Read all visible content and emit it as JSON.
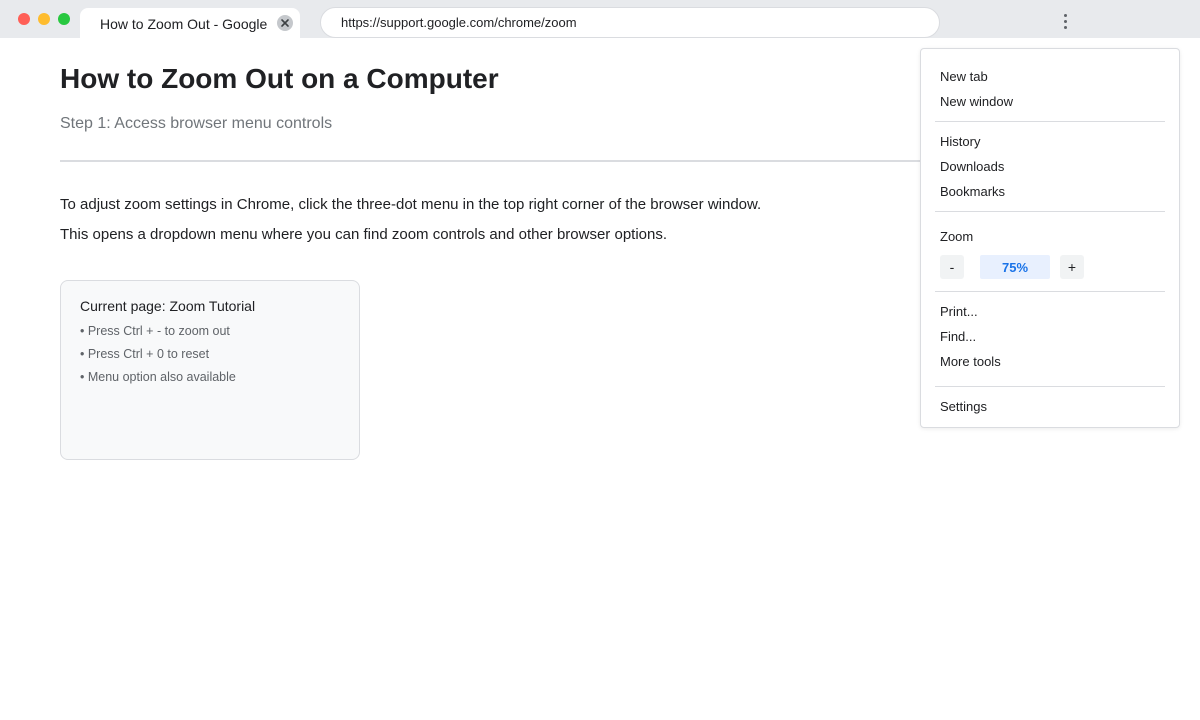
{
  "browser": {
    "tab": {
      "title": "How to Zoom Out - Google"
    },
    "address_bar": {
      "url": "https://support.google.com/chrome/zoom"
    },
    "colors": {
      "accent": "#1a73e8",
      "zoom_highlight": "#e8f0fe"
    },
    "icons": {
      "close_tab": "close-icon",
      "menu": "three-dot-menu-icon"
    }
  },
  "page": {
    "title": "How to Zoom Out on a Computer",
    "subtitle": "Step 1: Access browser menu controls",
    "paragraphs": [
      "To adjust zoom settings in Chrome, click the three-dot menu in the top right corner of the browser window.",
      "This opens a dropdown menu where you can find zoom controls and other browser options."
    ],
    "info_card": {
      "title": "Current page: Zoom Tutorial",
      "items": [
        "• Press Ctrl + - to zoom out",
        "• Press Ctrl + 0 to reset",
        "• Menu option also available"
      ]
    }
  },
  "menu": {
    "new_tab": "New tab",
    "new_window": "New window",
    "history": "History",
    "downloads": "Downloads",
    "bookmarks": "Bookmarks",
    "zoom": {
      "label": "Zoom",
      "decrease": "-",
      "value": "75%",
      "increase": "+"
    },
    "print": "Print...",
    "find": "Find...",
    "more_tools": "More tools",
    "settings": "Settings"
  }
}
